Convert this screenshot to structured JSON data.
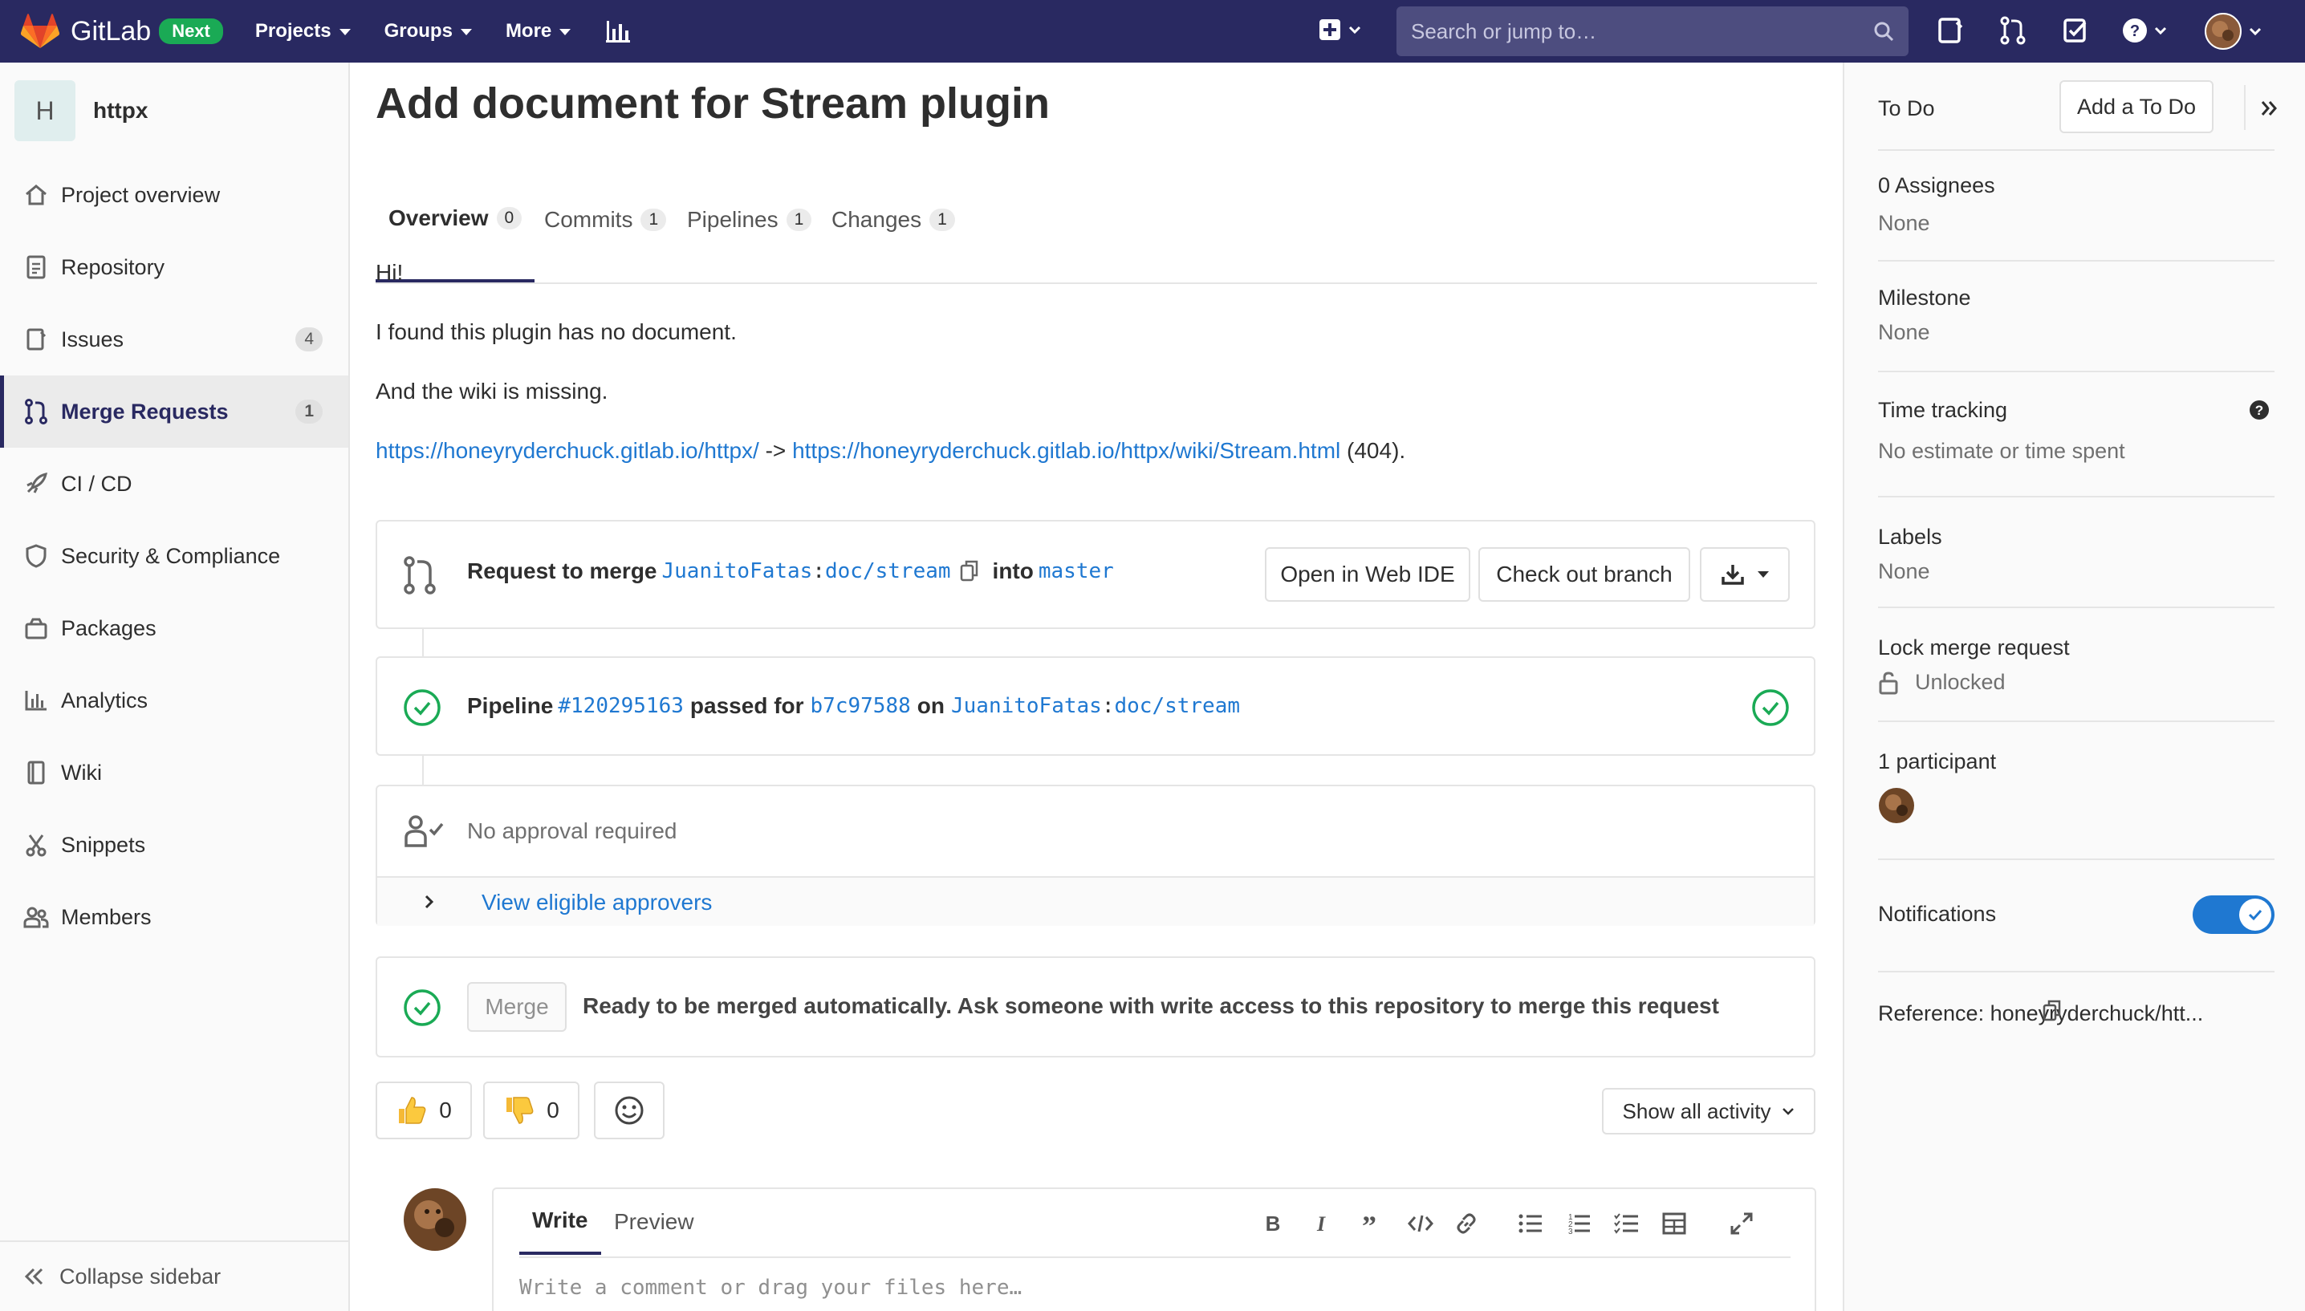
{
  "topnav": {
    "brand": "GitLab",
    "badge": "Next",
    "menu": [
      "Projects",
      "Groups",
      "More"
    ],
    "search_placeholder": "Search or jump to…"
  },
  "sidebar": {
    "project_letter": "H",
    "project_name": "httpx",
    "items": [
      {
        "label": "Project overview",
        "icon": "home-icon"
      },
      {
        "label": "Repository",
        "icon": "doc-icon"
      },
      {
        "label": "Issues",
        "icon": "issues-icon",
        "count": "4"
      },
      {
        "label": "Merge Requests",
        "icon": "merge-request-icon",
        "count": "1",
        "active": true
      },
      {
        "label": "CI / CD",
        "icon": "rocket-icon"
      },
      {
        "label": "Security & Compliance",
        "icon": "shield-icon"
      },
      {
        "label": "Packages",
        "icon": "package-icon"
      },
      {
        "label": "Analytics",
        "icon": "chart-icon"
      },
      {
        "label": "Wiki",
        "icon": "book-icon"
      },
      {
        "label": "Snippets",
        "icon": "scissors-icon"
      },
      {
        "label": "Members",
        "icon": "users-icon"
      }
    ],
    "collapse_label": "Collapse sidebar"
  },
  "main": {
    "title": "Add document for Stream plugin",
    "tabs": [
      {
        "label": "Overview",
        "count": "0"
      },
      {
        "label": "Commits",
        "count": "1"
      },
      {
        "label": "Pipelines",
        "count": "1"
      },
      {
        "label": "Changes",
        "count": "1"
      }
    ],
    "description": {
      "line1": "Hi!",
      "line2": "I found this plugin has no document.",
      "line3": "And the wiki is missing.",
      "link1": "https://honeyryderchuck.gitlab.io/httpx/",
      "arrow": " -> ",
      "link2": "https://honeyryderchuck.gitlab.io/httpx/wiki/Stream.html",
      "suffix": " (404)."
    },
    "merge_widget": {
      "request_label": "Request to merge",
      "source_user": "JuanitoFatas",
      "source_branch": "doc/stream",
      "into_label": "into",
      "target_branch": "master",
      "open_ide": "Open in Web IDE",
      "checkout": "Check out branch"
    },
    "pipeline": {
      "label": "Pipeline",
      "id": "#120295163",
      "passed_for": "passed for",
      "commit": "b7c97588",
      "on": "on",
      "user": "JuanitoFatas",
      "branch": "doc/stream"
    },
    "approval": {
      "text": "No approval required",
      "view_link": "View eligible approvers"
    },
    "merge": {
      "button": "Merge",
      "text": "Ready to be merged automatically. Ask someone with write access to this repository to merge this request"
    },
    "reactions": {
      "thumbs_up": "0",
      "thumbs_down": "0"
    },
    "activity_filter": "Show all activity",
    "editor": {
      "tab_write": "Write",
      "tab_preview": "Preview",
      "placeholder": "Write a comment or drag your files here…"
    }
  },
  "right_sidebar": {
    "todo_label": "To Do",
    "todo_button": "Add a To Do",
    "assignees_title": "0 Assignees",
    "assignees_value": "None",
    "milestone_title": "Milestone",
    "milestone_value": "None",
    "time_title": "Time tracking",
    "time_value": "No estimate or time spent",
    "labels_title": "Labels",
    "labels_value": "None",
    "lock_title": "Lock merge request",
    "lock_value": "Unlocked",
    "participants_title": "1 participant",
    "notifications_title": "Notifications",
    "notifications_on": true,
    "reference": "Reference: honeyryderchuck/htt..."
  },
  "colors": {
    "nav_bg": "#292961",
    "link": "#1f78d1",
    "success": "#1aaa55",
    "toggle": "#1f78d1"
  }
}
